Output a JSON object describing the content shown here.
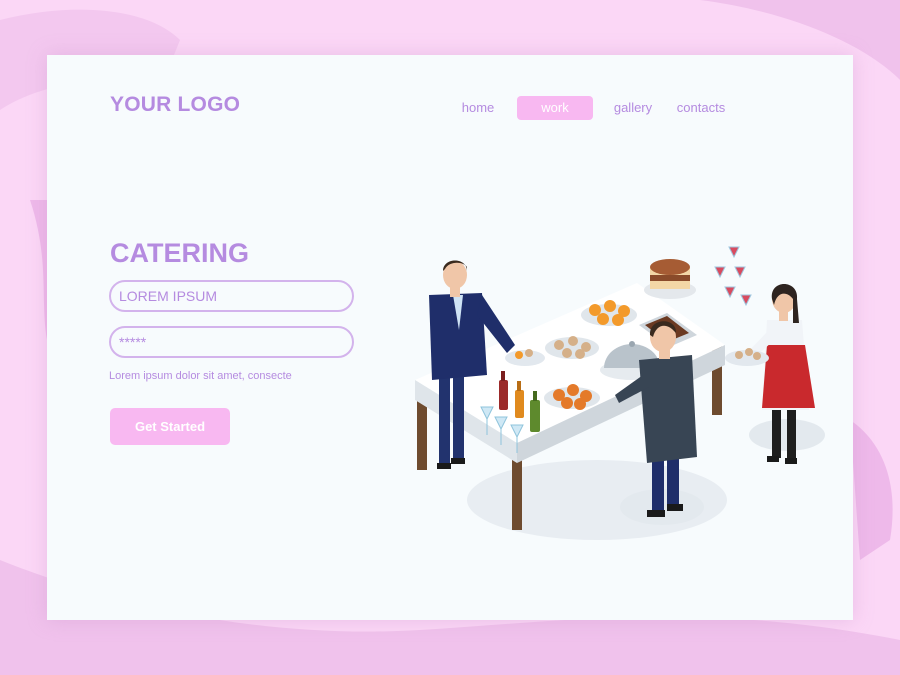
{
  "header": {
    "logo": "YOUR LOGO",
    "nav": [
      {
        "label": "home",
        "active": false
      },
      {
        "label": "work",
        "active": true
      },
      {
        "label": "gallery",
        "active": false
      },
      {
        "label": "contacts",
        "active": false
      }
    ]
  },
  "hero": {
    "title": "CATERING",
    "fields": {
      "name_placeholder": "LOREM IPSUM",
      "password_placeholder": "*****"
    },
    "hint": "Lorem ipsum dolor sit amet, consecte",
    "cta_label": "Get Started"
  },
  "colors": {
    "accent": "#b58be0",
    "button": "#f8b8f1",
    "page_background": "#fbd7f6",
    "card_background": "#f7fbfd"
  },
  "illustration": {
    "subject": "catering-buffet-scene"
  }
}
